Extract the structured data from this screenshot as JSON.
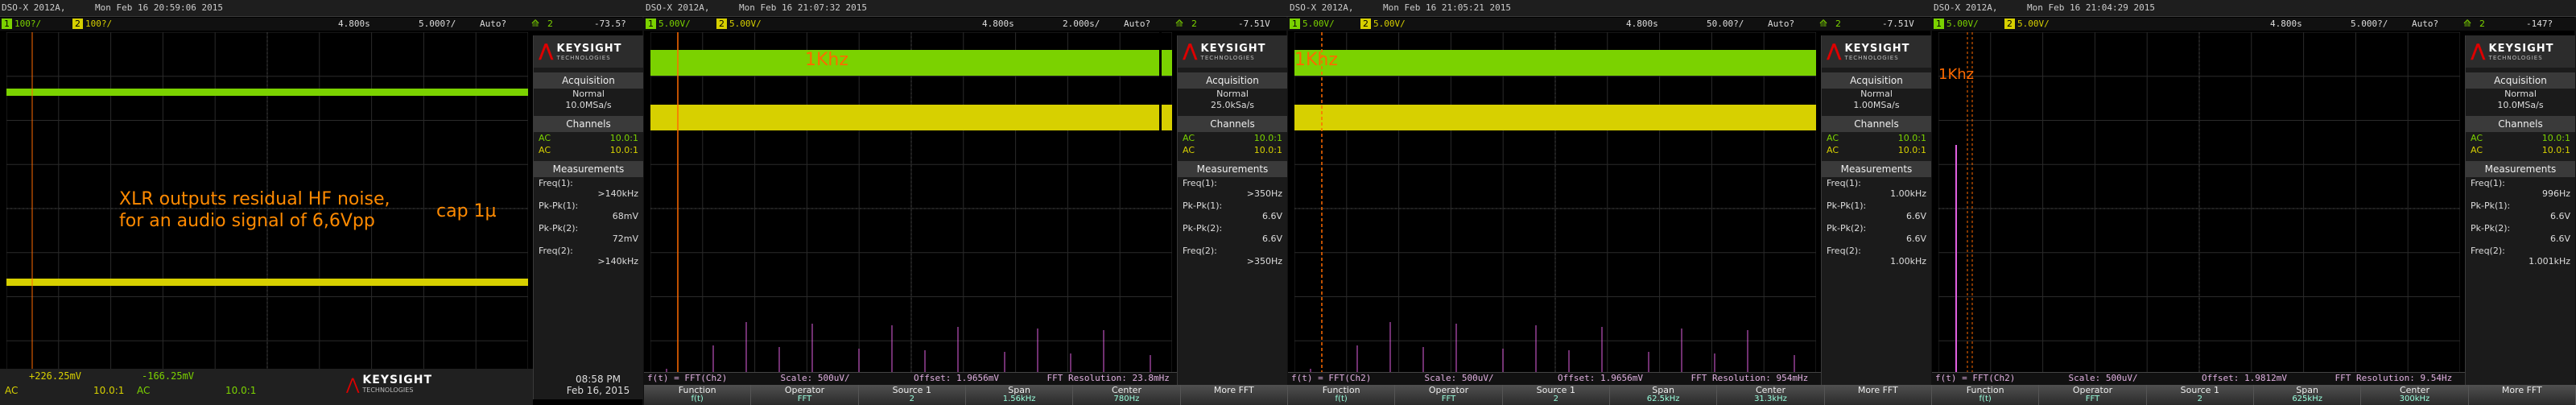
{
  "colors": {
    "ch1": "#7bd200",
    "ch2": "#d7d000",
    "math": "#e060e0",
    "accent": "#ff7a00",
    "cursor": "#ff6a00"
  },
  "scopes": [
    {
      "model": "DSO-X 2012A,",
      "date": "Mon Feb 16 20:59:06 2015",
      "ch1_scale": "100?/",
      "ch2_scale": "100?/",
      "time_pos": "4.800s",
      "time_scale": "5.000?/",
      "trig": "Auto?",
      "trig_level": "-73.5?",
      "acq_mode": "Normal",
      "acq_rate": "10.0MSa/s",
      "ch1_coup": "AC",
      "ch1_val": "10.0:1",
      "ch2_coup": "AC",
      "ch2_val": "10.0:1",
      "meas": [
        {
          "label": "Freq(1):",
          "value": ">140kHz"
        },
        {
          "label": "Pk-Pk(1):",
          "value": "68mV"
        },
        {
          "label": "Pk-Pk(2):",
          "value": "72mV"
        },
        {
          "label": "Freq(2):",
          "value": ">140kHz"
        }
      ],
      "annot1": "XLR outputs residual HF noise,",
      "annot2": "for an audio signal of 6,6Vpp",
      "annot3": "cap 1µ",
      "cursor1": "+226.25mV",
      "cursor2": "-166.25mV",
      "cur_val1": "10.0:1",
      "cur_val2": "10.0:1",
      "cur_coup1": "AC",
      "cur_coup2": "AC",
      "clock_time": "08:58 PM",
      "clock_date": "Feb 16, 2015"
    },
    {
      "model": "DSO-X 2012A,",
      "date": "Mon Feb 16 21:07:32 2015",
      "ch1_scale": "5.00V/",
      "ch2_scale": "5.00V/",
      "time_pos": "4.800s",
      "time_scale": "2.000s/",
      "trig": "Auto?",
      "trig_level": "-7.51V",
      "acq_mode": "Normal",
      "acq_rate": "25.0kSa/s",
      "ch1_coup": "AC",
      "ch1_val": "10.0:1",
      "ch2_coup": "AC",
      "ch2_val": "10.0:1",
      "meas": [
        {
          "label": "Freq(1):",
          "value": ">350Hz"
        },
        {
          "label": "Pk-Pk(1):",
          "value": "6.6V"
        },
        {
          "label": "Pk-Pk(2):",
          "value": "6.6V"
        },
        {
          "label": "Freq(2):",
          "value": ">350Hz"
        }
      ],
      "marker": "1Khz",
      "fft": [
        "f(t) = FFT(Ch2)",
        "Scale: 500uV/",
        "Offset: 1.9656mV",
        "FFT Resolution: 23.8mHz"
      ],
      "soft": [
        {
          "t": "Function",
          "s": "f(t)"
        },
        {
          "t": "Operator",
          "s": "FFT"
        },
        {
          "t": "Source 1",
          "s": "2"
        },
        {
          "t": "Span",
          "s": "1.56kHz"
        },
        {
          "t": "Center",
          "s": "780Hz"
        },
        {
          "t": "More FFT",
          "s": ""
        }
      ]
    },
    {
      "model": "DSO-X 2012A,",
      "date": "Mon Feb 16 21:05:21 2015",
      "ch1_scale": "5.00V/",
      "ch2_scale": "5.00V/",
      "time_pos": "4.800s",
      "time_scale": "50.00?/",
      "trig": "Auto?",
      "trig_level": "-7.51V",
      "acq_mode": "Normal",
      "acq_rate": "1.00MSa/s",
      "ch1_coup": "AC",
      "ch1_val": "10.0:1",
      "ch2_coup": "AC",
      "ch2_val": "10.0:1",
      "meas": [
        {
          "label": "Freq(1):",
          "value": "1.00kHz"
        },
        {
          "label": "Pk-Pk(1):",
          "value": "6.6V"
        },
        {
          "label": "Pk-Pk(2):",
          "value": "6.6V"
        },
        {
          "label": "Freq(2):",
          "value": "1.00kHz"
        }
      ],
      "marker": "1Khz",
      "fft": [
        "f(t) = FFT(Ch2)",
        "Scale: 500uV/",
        "Offset: 1.9656mV",
        "FFT Resolution: 954mHz"
      ],
      "soft": [
        {
          "t": "Function",
          "s": "f(t)"
        },
        {
          "t": "Operator",
          "s": "FFT"
        },
        {
          "t": "Source 1",
          "s": "2"
        },
        {
          "t": "Span",
          "s": "62.5kHz"
        },
        {
          "t": "Center",
          "s": "31.3kHz"
        },
        {
          "t": "More FFT",
          "s": ""
        }
      ]
    },
    {
      "model": "DSO-X 2012A,",
      "date": "Mon Feb 16 21:04:29 2015",
      "ch1_scale": "5.00V/",
      "ch2_scale": "5.00V/",
      "time_pos": "4.800s",
      "time_scale": "5.000?/",
      "trig": "Auto?",
      "trig_level": "-147?",
      "acq_mode": "Normal",
      "acq_rate": "10.0MSa/s",
      "ch1_coup": "AC",
      "ch1_val": "10.0:1",
      "ch2_coup": "AC",
      "ch2_val": "10.0:1",
      "meas": [
        {
          "label": "Freq(1):",
          "value": "996Hz"
        },
        {
          "label": "Pk-Pk(1):",
          "value": "6.6V"
        },
        {
          "label": "Pk-Pk(2):",
          "value": "6.6V"
        },
        {
          "label": "Freq(2):",
          "value": "1.001kHz"
        }
      ],
      "marker": "1Khz",
      "fft": [
        "f(t) = FFT(Ch2)",
        "Scale: 500uV/",
        "Offset: 1.9812mV",
        "FFT Resolution: 9.54Hz"
      ],
      "soft": [
        {
          "t": "Function",
          "s": "f(t)"
        },
        {
          "t": "Operator",
          "s": "FFT"
        },
        {
          "t": "Source 1",
          "s": "2"
        },
        {
          "t": "Span",
          "s": "625kHz"
        },
        {
          "t": "Center",
          "s": "300kHz"
        },
        {
          "t": "More FFT",
          "s": ""
        }
      ]
    }
  ],
  "brand": {
    "name": "KEYSIGHT",
    "sub": "TECHNOLOGIES"
  },
  "labels": {
    "acquisition": "Acquisition",
    "channels": "Channels",
    "measurements": "Measurements"
  }
}
